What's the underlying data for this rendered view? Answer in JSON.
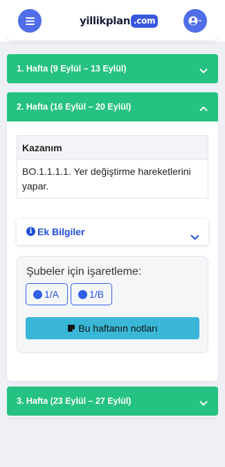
{
  "header": {
    "logo_text": "yillikplan",
    "logo_tag": ".com",
    "menu_icon": "hamburger-icon",
    "user_icon": "user-circle-icon",
    "accent": "#4f6ee8"
  },
  "weeks": [
    {
      "title": "1. Hafta (9 Eylül – 13 Eylül)",
      "expanded": false
    },
    {
      "title": "2. Hafta (16 Eylül – 20 Eylül)",
      "expanded": true
    },
    {
      "title": "3. Hafta (23 Eylül – 27 Eylül)",
      "expanded": false
    }
  ],
  "week_color": "#26c281",
  "week_detail": {
    "kazanim_header": "Kazanım",
    "kazanim_text": "BO.1.1.1.1. Yer değiştirme hareketlerini yapar.",
    "ek_bilgiler_label": "Ek Bilgiler",
    "subeler_title": "Şubeler için işaretleme:",
    "subeler": [
      "1/A",
      "1/B"
    ],
    "notes_button": "Bu haftanın notları"
  }
}
